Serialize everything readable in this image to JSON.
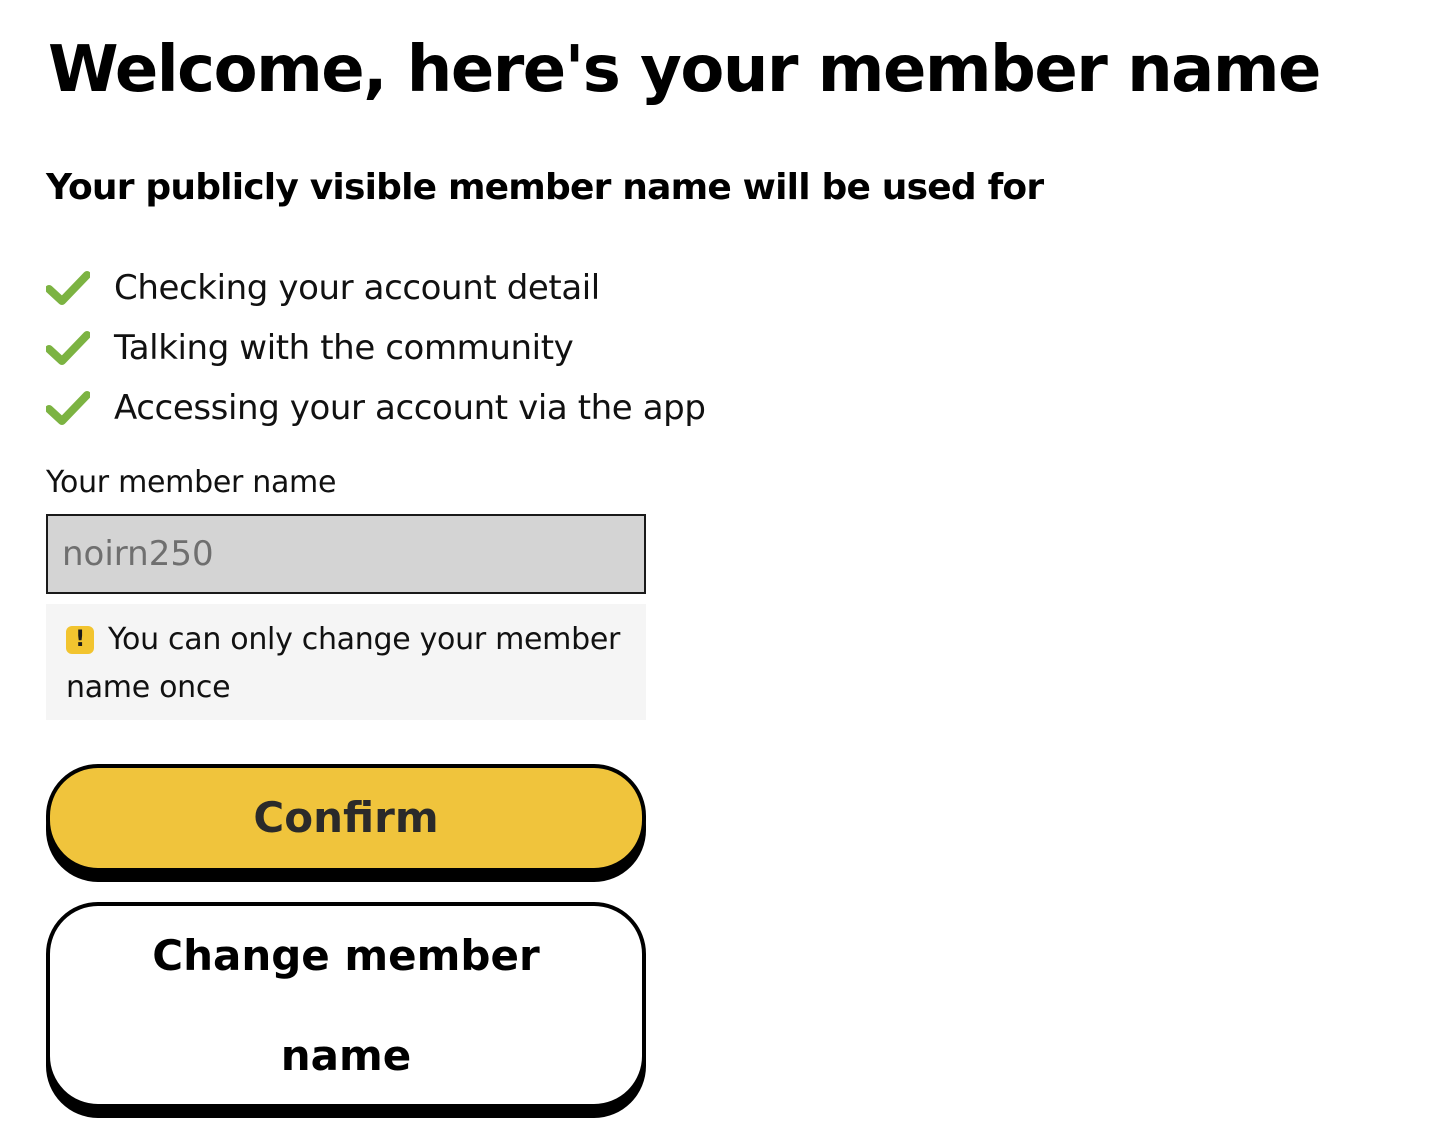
{
  "page": {
    "title": "Welcome, here's your member name",
    "subtitle": "Your publicly visible member name will be used for"
  },
  "benefits": [
    {
      "icon": "checkmark-icon",
      "text": "Checking your account detail"
    },
    {
      "icon": "checkmark-icon",
      "text": "Talking with the community"
    },
    {
      "icon": "checkmark-icon",
      "text": "Accessing your account via the app"
    }
  ],
  "member_name": {
    "label": "Your member name",
    "value": "noirn250",
    "readonly": true
  },
  "notice": {
    "icon": "warning-icon",
    "icon_glyph": "!",
    "text": "You can only change your member name once"
  },
  "buttons": {
    "confirm_label": "Confirm",
    "change_label": "Change member name"
  },
  "colors": {
    "check": "#7cb342",
    "accent": "#f0c43c",
    "warning": "#f2c42f",
    "input_bg": "#d4d4d4",
    "notice_bg": "#f5f5f5"
  }
}
